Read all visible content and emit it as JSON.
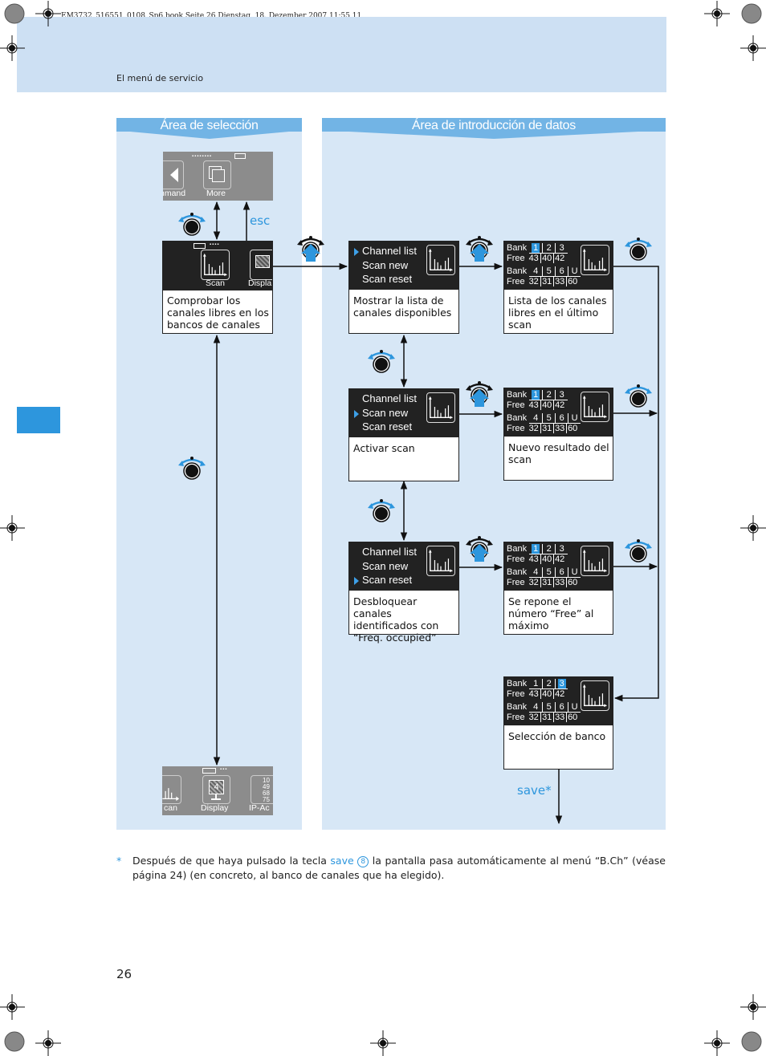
{
  "print_info": "EM3732_516551_0108_Sp6.book  Seite 26  Dienstag, 18. Dezember 2007  11:55 11",
  "section_title": "El menú de servicio",
  "panels": {
    "selection": "Área de selección",
    "input": "Área de introducción de datos"
  },
  "left_column": {
    "top_screen": {
      "labels": [
        "nmand",
        "More"
      ]
    },
    "scan_screen": {
      "labels": [
        "Scan",
        "Displa"
      ],
      "caption": "Comprobar los canales libres en los bancos de canales"
    },
    "bottom_screen": {
      "labels": [
        "can",
        "Display",
        "IP-Ac"
      ],
      "ip_numbers": [
        "10",
        "49",
        "68",
        "75"
      ],
      "display_number": "4"
    },
    "esc_label": "esc"
  },
  "menu_items": [
    "Channel list",
    "Scan new",
    "Scan reset"
  ],
  "menu_screens": [
    {
      "selected_index": 0,
      "caption": "Mostrar la lista de canales disponibles"
    },
    {
      "selected_index": 1,
      "caption": "Activar scan"
    },
    {
      "selected_index": 2,
      "caption": "Desbloquear canales identificados con “Freq. occupied”"
    }
  ],
  "bank_table": {
    "bank_label": "Bank",
    "free_label": "Free",
    "row1_banks": [
      "1",
      "2",
      "3"
    ],
    "row1_free": [
      "43",
      "40",
      "42"
    ],
    "row2_banks": [
      "4",
      "5",
      "6",
      "U"
    ],
    "row2_free": [
      "32",
      "31",
      "33",
      "60"
    ]
  },
  "bank_screens": [
    {
      "highlight_bank": "1",
      "caption": "Lista de los canales libres en el último scan"
    },
    {
      "highlight_bank": "1",
      "caption": "Nuevo resultado del scan"
    },
    {
      "highlight_bank": "1",
      "caption": "Se repone el número “Free” al máximo"
    },
    {
      "highlight_bank": "3",
      "caption": "Selección de banco"
    }
  ],
  "save_label": "save*",
  "footnote": {
    "star": "*",
    "before": "Después de que haya pulsado la tecla ",
    "key": "save",
    "key_number": "8",
    "after": " la pantalla pasa automáticamente al menú “B.Ch” (véase página 24) (en concreto, al banco de canales que ha elegido)."
  },
  "page_number": "26",
  "colors": {
    "accent": "#2d96dd",
    "panel": "#d7e7f6",
    "header": "#cde0f3",
    "panel_head": "#72b4e5"
  }
}
